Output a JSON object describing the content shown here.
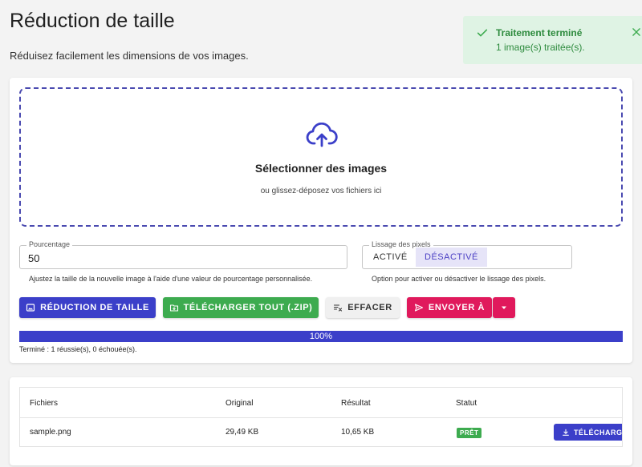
{
  "header": {
    "title": "Réduction de taille",
    "subtitle": "Réduisez facilement les dimensions de vos images."
  },
  "toast": {
    "title": "Traitement terminé",
    "message": "1 image(s) traitée(s)."
  },
  "dropzone": {
    "title": "Sélectionner des images",
    "hint": "ou glissez-déposez vos fichiers ici",
    "icon": "cloud-upload-icon"
  },
  "percentage": {
    "label": "Pourcentage",
    "value": "50",
    "help": "Ajustez la taille de la nouvelle image à l'aide d'une valeur de pourcentage personnalisée."
  },
  "smoothing": {
    "label": "Lissage des pixels",
    "on_label": "ACTIVÉ",
    "off_label": "DÉSACTIVÉ",
    "selected": "DÉSACTIVÉ",
    "help": "Option pour activer ou désactiver le lissage des pixels."
  },
  "actions": {
    "resize_label": "RÉDUCTION DE TAILLE",
    "zip_label": "TÉLÉCHARGER TOUT (.ZIP)",
    "clear_label": "EFFACER",
    "send_label": "ENVOYER À"
  },
  "progress": {
    "percent": 100,
    "text": "100%",
    "status": "Terminé : 1 réussie(s), 0 échouée(s)."
  },
  "table": {
    "headers": [
      "Fichiers",
      "Original",
      "Résultat",
      "Statut"
    ],
    "rows": [
      {
        "file": "sample.png",
        "original": "29,49 KB",
        "result": "10,65 KB",
        "status": "PRÊT",
        "action_label": "TÉLÉCHARGER"
      }
    ]
  },
  "colors": {
    "primary": "#3b3fc9",
    "success": "#3dab4f",
    "danger": "#e0195c",
    "toast_bg": "#dff3e4"
  }
}
